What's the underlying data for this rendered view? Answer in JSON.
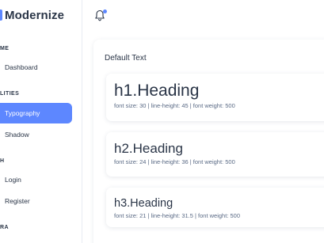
{
  "app": {
    "brand": "Modernize"
  },
  "sidebar": {
    "sections": [
      {
        "label": "ME"
      },
      {
        "label": "LITIES"
      },
      {
        "label": "H"
      },
      {
        "label": "RA"
      }
    ],
    "items": [
      {
        "label": "Dashboard"
      },
      {
        "label": "Typography"
      },
      {
        "label": "Shadow"
      },
      {
        "label": "Login"
      },
      {
        "label": "Register"
      }
    ]
  },
  "main": {
    "card_title": "Default Text",
    "headings": [
      {
        "text": "h1.Heading",
        "meta": "font size: 30 | line-height: 45 | font weight: 500"
      },
      {
        "text": "h2.Heading",
        "meta": "font size: 24 | line-height: 36 | font weight: 500"
      },
      {
        "text": "h3.Heading",
        "meta": "font size: 21 | line-height: 31.5 | font weight: 500"
      }
    ]
  },
  "colors": {
    "primary": "#5d87ff",
    "text": "#2a3547",
    "muted": "#5a6a85"
  },
  "icons": {
    "notifications": "bell-icon"
  }
}
